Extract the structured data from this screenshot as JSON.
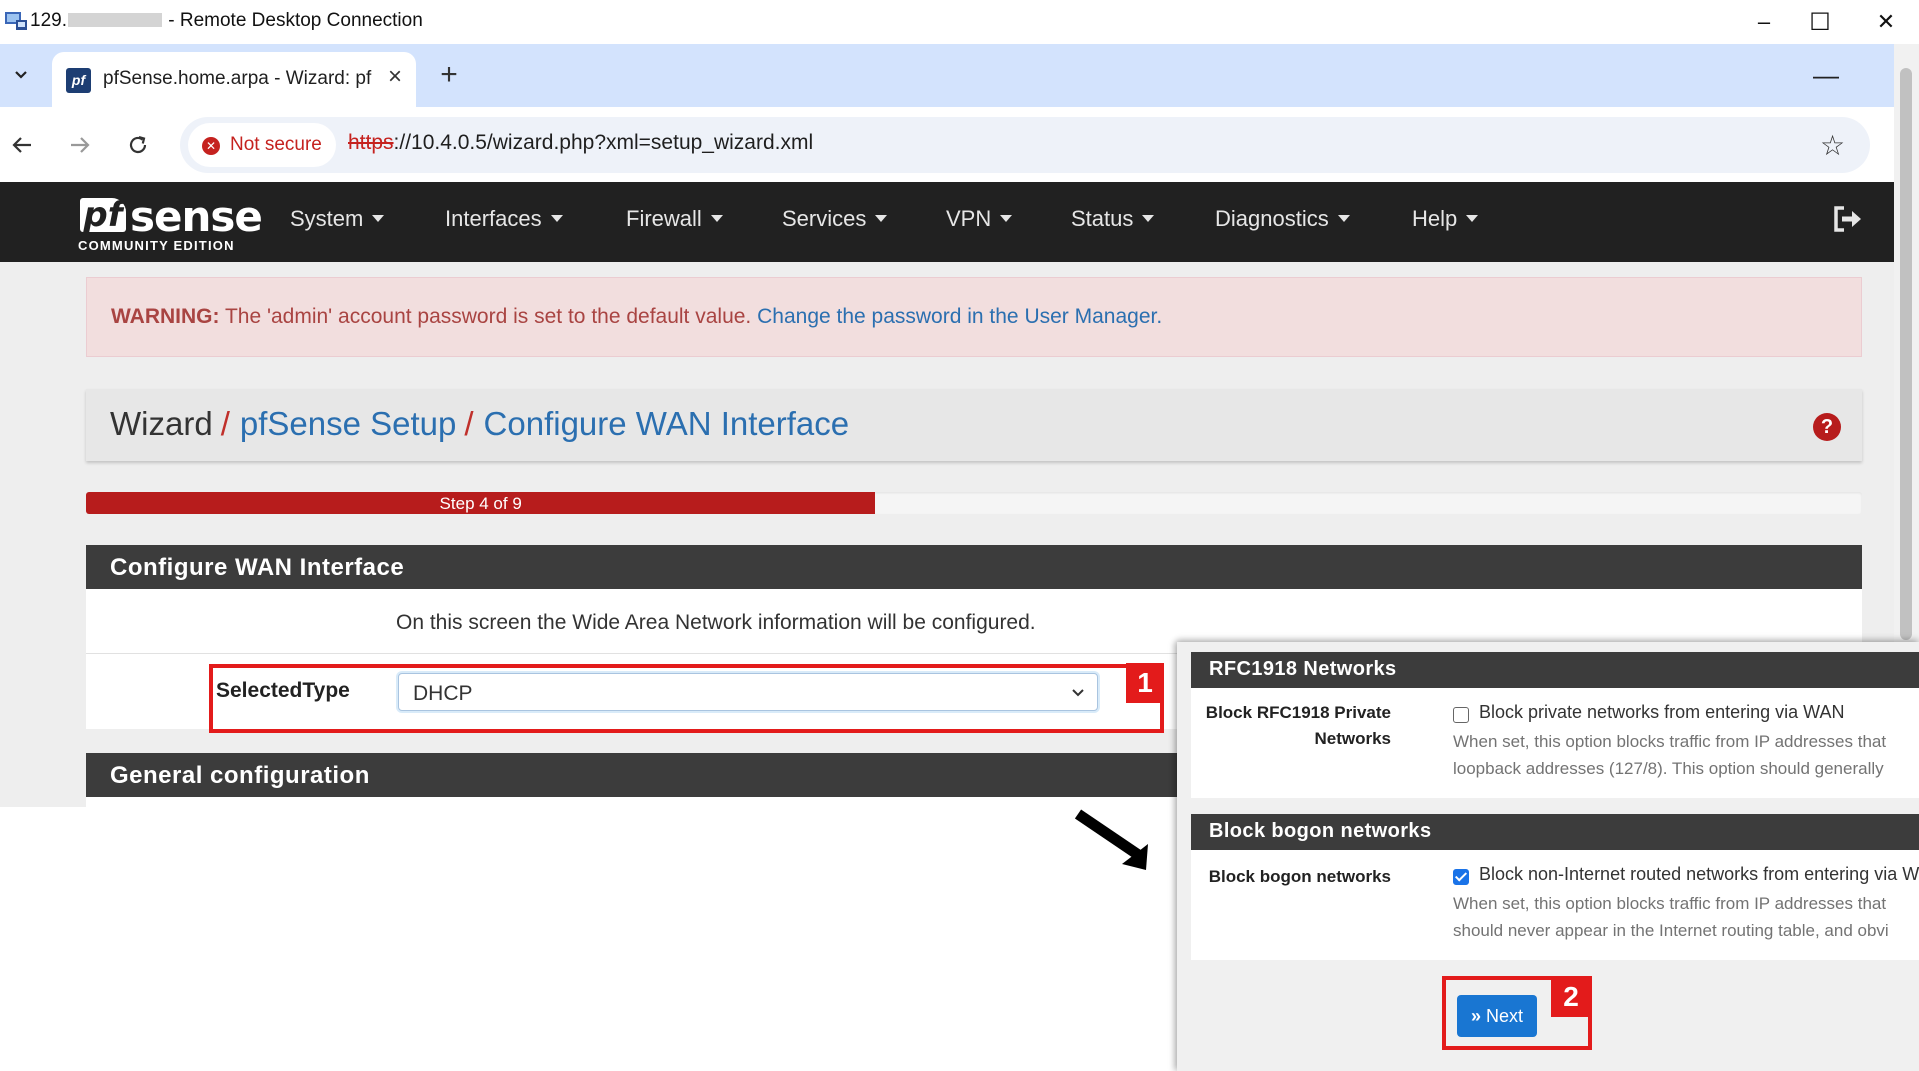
{
  "rdp": {
    "title_prefix": "129.",
    "title_suffix": " - Remote Desktop Connection",
    "minimize": "–",
    "maximize": "☐",
    "close": "✕"
  },
  "browser": {
    "tab_title": "pfSense.home.arpa - Wizard: pf",
    "tab_favicon": "pf",
    "new_tab": "+",
    "security_label": "Not secure",
    "url_scheme": "https",
    "url_rest": "://10.4.0.5/wizard.php?xml=setup_wizard.xml",
    "icons": [
      "back-arrow-icon",
      "forward-arrow-icon",
      "reload-icon",
      "star-icon"
    ]
  },
  "pfsense": {
    "logo_text": "sense",
    "logo_mark": "pf",
    "logo_edition": "COMMUNITY EDITION",
    "menu": [
      "System",
      "Interfaces",
      "Firewall",
      "Services",
      "VPN",
      "Status",
      "Diagnostics",
      "Help"
    ],
    "warning_strong": "WARNING:",
    "warning_text": " The 'admin' account password is set to the default value. ",
    "warning_link": "Change the password in the User Manager.",
    "breadcrumb": [
      "Wizard",
      "pfSense Setup",
      "Configure WAN Interface"
    ],
    "help_icon": "?",
    "progress": {
      "label": "Step 4 of 9",
      "current": 4,
      "total": 9
    },
    "wan_panel_title": "Configure WAN Interface",
    "wan_description": "On this screen the Wide Area Network information will be configured.",
    "selectedtype_label": "SelectedType",
    "selectedtype_value": "DHCP",
    "general_panel_title": "General configuration"
  },
  "overlay": {
    "rfc_title": "RFC1918 Networks",
    "rfc_label_line1": "Block RFC1918 Private",
    "rfc_label_line2": "Networks",
    "rfc_checkbox_text": "Block private networks from entering via WAN",
    "rfc_checked": false,
    "rfc_help_line1": "When set, this option blocks traffic from IP addresses that",
    "rfc_help_line2": "loopback addresses (127/8). This option should generally",
    "bogon_title": "Block bogon networks",
    "bogon_label": "Block bogon networks",
    "bogon_checkbox_text": "Block non-Internet routed networks from entering via W",
    "bogon_checked": true,
    "bogon_help_line1": "When set, this option blocks traffic from IP addresses that",
    "bogon_help_line2": "should never appear in the Internet routing table, and obvi",
    "next_label": "Next",
    "next_icon": "»"
  },
  "annotations": {
    "badge_1": "1",
    "badge_2": "2",
    "color": "#e31b1b"
  },
  "colors": {
    "pfsense_red": "#b71c1c",
    "navbar": "#212121",
    "link_blue": "#2b6fb0",
    "button_blue": "#1976d2"
  }
}
